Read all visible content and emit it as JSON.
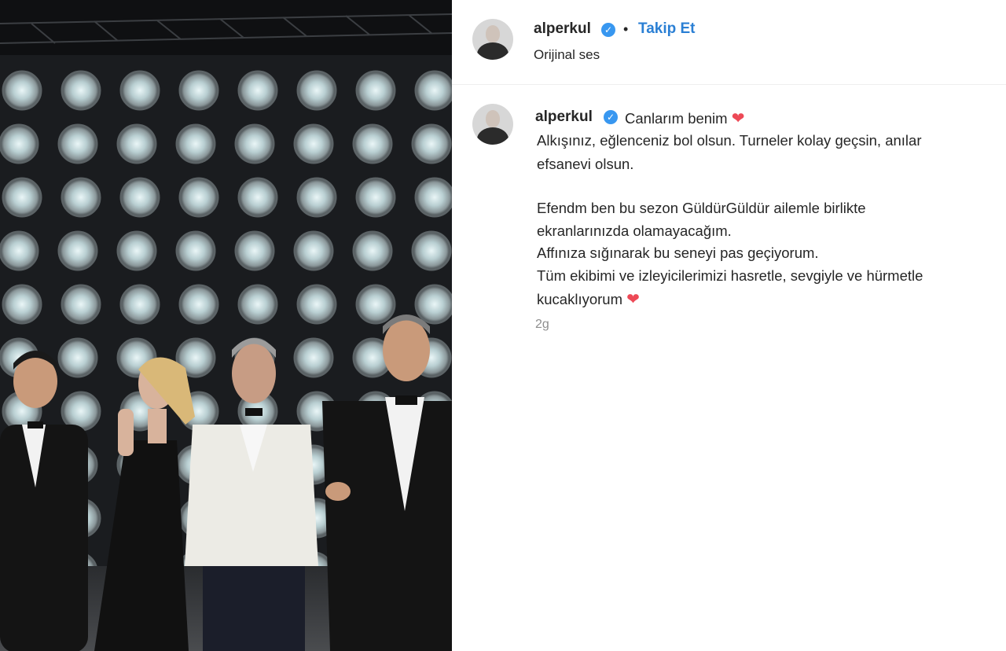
{
  "post": {
    "username": "alperkul",
    "follow_label": "Takip Et",
    "separator": "•",
    "audio_label": "Orijinal ses"
  },
  "caption": {
    "username": "alperkul",
    "first_line": "Canlarım benim",
    "lines": [
      "Alkışınız, eğlenceniz bol olsun. Turneler kolay geçsin, anılar",
      "efsanevi olsun.",
      "",
      "Efendm ben bu sezon GüldürGüldür ailemle birlikte",
      "ekranlarınızda olamayacağım.",
      "Affınıza sığınarak bu seneyi pas geçiyorum.",
      "Tüm ekibimi ve izleyicilerimizi hasretle, sevgiyle ve hürmetle",
      "kucaklıyorum"
    ],
    "heart_emoji": "❤",
    "time": "2g"
  },
  "colors": {
    "link": "#2a7fd4",
    "verified": "#3897f0",
    "heart": "#ed4956",
    "muted": "#8e8e8e"
  },
  "icons": [
    "verified-badge-icon",
    "heart-emoji-icon"
  ]
}
